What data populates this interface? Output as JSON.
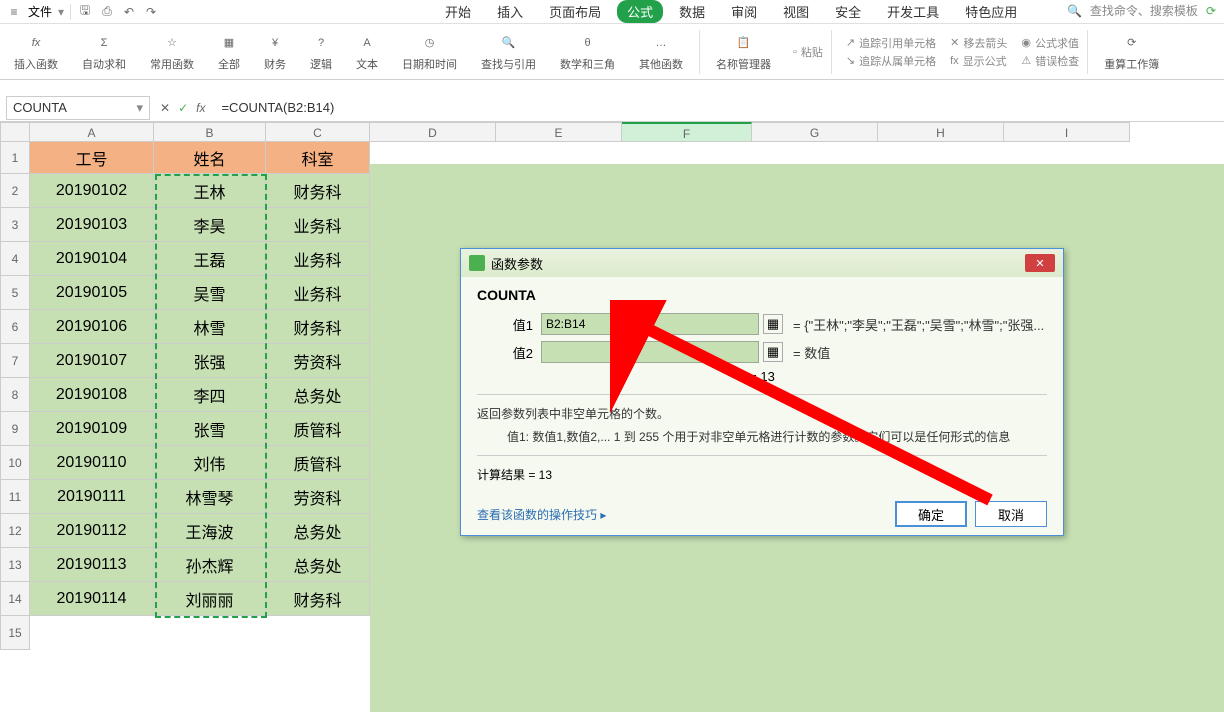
{
  "menu": {
    "file": "文件"
  },
  "tabs": {
    "start": "开始",
    "insert": "插入",
    "layout": "页面布局",
    "formula": "公式",
    "data": "数据",
    "review": "审阅",
    "view": "视图",
    "security": "安全",
    "devtools": "开发工具",
    "special": "特色应用"
  },
  "search": {
    "placeholder": "查找命令、搜索模板"
  },
  "ribbon": {
    "insert_func": "插入函数",
    "autosum": "自动求和",
    "common": "常用函数",
    "all": "全部",
    "finance": "财务",
    "logic": "逻辑",
    "text": "文本",
    "datetime": "日期和时间",
    "lookup": "查找与引用",
    "math": "数学和三角",
    "other": "其他函数",
    "name_mgr": "名称管理器",
    "paste_name": "粘贴",
    "trace_pre": "追踪引用单元格",
    "trace_dep": "追踪从属单元格",
    "remove_arrows": "移去箭头",
    "show_formula": "显示公式",
    "eval": "公式求值",
    "error_check": "错误检查",
    "recalc": "重算工作簿"
  },
  "name_box": "COUNTA",
  "formula": "=COUNTA(B2:B14)",
  "cols": [
    "A",
    "B",
    "C",
    "D",
    "E",
    "F",
    "G",
    "H",
    "I"
  ],
  "headers": {
    "a": "工号",
    "b": "姓名",
    "c": "科室"
  },
  "data": [
    {
      "a": "20190102",
      "b": "王林",
      "c": "财务科"
    },
    {
      "a": "20190103",
      "b": "李昊",
      "c": "业务科"
    },
    {
      "a": "20190104",
      "b": "王磊",
      "c": "业务科"
    },
    {
      "a": "20190105",
      "b": "吴雪",
      "c": "业务科"
    },
    {
      "a": "20190106",
      "b": "林雪",
      "c": "财务科"
    },
    {
      "a": "20190107",
      "b": "张强",
      "c": "劳资科"
    },
    {
      "a": "20190108",
      "b": "李四",
      "c": "总务处"
    },
    {
      "a": "20190109",
      "b": "张雪",
      "c": "质管科"
    },
    {
      "a": "20190110",
      "b": "刘伟",
      "c": "质管科"
    },
    {
      "a": "20190111",
      "b": "林雪琴",
      "c": "劳资科"
    },
    {
      "a": "20190112",
      "b": "王海波",
      "c": "总务处"
    },
    {
      "a": "20190113",
      "b": "孙杰辉",
      "c": "总务处"
    },
    {
      "a": "20190114",
      "b": "刘丽丽",
      "c": "财务科"
    }
  ],
  "dialog": {
    "title": "函数参数",
    "func": "COUNTA",
    "arg1_label": "值1",
    "arg1_value": "B2:B14",
    "arg1_eval": "= {\"王林\";\"李昊\";\"王磊\";\"吴雪\";\"林雪\";\"张强...",
    "arg2_label": "值2",
    "arg2_eval": "= 数值",
    "result_only": "= 13",
    "desc": "返回参数列表中非空单元格的个数。",
    "arg_desc": "值1: 数值1,数值2,... 1 到 255 个用于对非空单元格进行计数的参数。它们可以是任何形式的信息",
    "calc_result": "计算结果 = 13",
    "link": "查看该函数的操作技巧",
    "ok": "确定",
    "cancel": "取消"
  }
}
